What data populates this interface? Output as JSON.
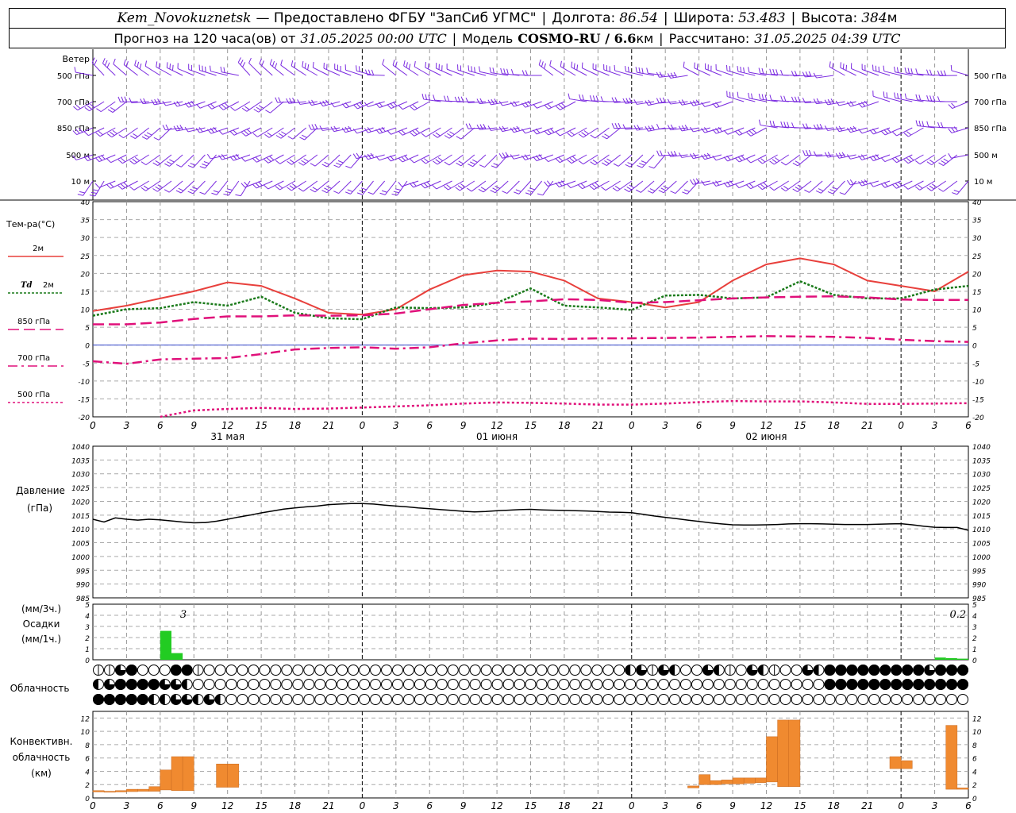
{
  "header": {
    "station": "Kem_Novokuznetsk",
    "provider": "— Предоставлено ФГБУ \"ЗапСиб УГМС\"",
    "lon_label": "Долгота:",
    "lon": "86.54",
    "lat_label": "Широта:",
    "lat": "53.483",
    "alt_label": "Высота:",
    "alt": "384",
    "alt_unit": "м",
    "forecast_label": "Прогноз на 120 часа(ов) от",
    "forecast_time": "31.05.2025 00:00 UTC",
    "model_label": "Модель",
    "model": "COSMO-RU / 6.6",
    "model_unit": "км",
    "calc_label": "Рассчитано:",
    "calc_time": "31.05.2025 04:39 UTC"
  },
  "colors": {
    "t2m": "#e8403c",
    "td": "#1a7a1a",
    "t850": "#e0107a",
    "t700": "#e0107a",
    "t500": "#e0107a",
    "wind": "#7a2ae0",
    "pressure": "#000000",
    "precip": "#22cc22",
    "conv": "#f08a30"
  },
  "time_axis": {
    "hour_ticks": [
      "0",
      "3",
      "6",
      "9",
      "12",
      "15",
      "18",
      "21",
      "0",
      "3",
      "6",
      "9",
      "12",
      "15",
      "18",
      "21",
      "0",
      "3",
      "6",
      "9",
      "12",
      "15",
      "18",
      "21",
      "0",
      "3",
      "6"
    ],
    "day_labels": [
      {
        "step": 4,
        "text": "31 мая"
      },
      {
        "step": 12,
        "text": "01 июня"
      },
      {
        "step": 20,
        "text": "02 июня"
      }
    ]
  },
  "wind_panel": {
    "label_title": "Ветер",
    "levels": [
      "500 гПа",
      "700 гПа",
      "850 гПа",
      "500 м",
      "10 м"
    ]
  },
  "chart_data": [
    {
      "type": "line",
      "title": "Тем-ра(°С)",
      "ylim": [
        -20,
        40
      ],
      "yticks": [
        -20,
        -15,
        -10,
        -5,
        0,
        5,
        10,
        15,
        20,
        25,
        30,
        35,
        40
      ],
      "x_unit": "hours from 31.05.2025 00:00 UTC",
      "series": [
        {
          "name": "2м",
          "key": "t2m",
          "x": [
            0,
            3,
            6,
            9,
            12,
            15,
            18,
            21,
            24,
            27,
            30,
            33,
            36,
            39,
            42,
            45,
            48,
            51,
            54,
            57,
            60,
            63,
            66,
            69,
            72,
            75,
            78
          ],
          "values": [
            9.5,
            11,
            13,
            15,
            17.5,
            16.5,
            13,
            9,
            8.5,
            10,
            15.5,
            19.5,
            20.8,
            20.5,
            18,
            13,
            12,
            10.5,
            12,
            18,
            22.5,
            24.2,
            22.5,
            18,
            16.5,
            15,
            20.5
          ]
        },
        {
          "name": "Td 2м",
          "key": "td",
          "x": [
            0,
            3,
            6,
            9,
            12,
            15,
            18,
            21,
            24,
            27,
            30,
            33,
            36,
            39,
            42,
            45,
            48,
            51,
            54,
            57,
            60,
            63,
            66,
            69,
            72,
            75,
            78
          ],
          "values": [
            8.2,
            10,
            10.3,
            12,
            11,
            13.5,
            9,
            7.5,
            7.2,
            10.5,
            10.3,
            10.5,
            11.8,
            15.8,
            11,
            10.5,
            9.8,
            13.8,
            14,
            13,
            13.3,
            17.8,
            14,
            13,
            13,
            15.5,
            16.5
          ]
        },
        {
          "name": "850 гПа",
          "key": "t850",
          "x": [
            0,
            3,
            6,
            9,
            12,
            15,
            18,
            21,
            24,
            27,
            30,
            33,
            36,
            39,
            42,
            45,
            48,
            51,
            54,
            57,
            60,
            63,
            66,
            69,
            72,
            75,
            78
          ],
          "values": [
            5.8,
            5.8,
            6.3,
            7.3,
            8,
            8,
            8.3,
            8.2,
            8.3,
            8.8,
            10,
            11.2,
            11.8,
            12.2,
            12.8,
            12.6,
            11.8,
            12,
            12.5,
            13,
            13.3,
            13.5,
            13.6,
            13.3,
            12.7,
            12.6,
            12.6
          ]
        },
        {
          "name": "700 гПа",
          "key": "t700",
          "x": [
            0,
            3,
            6,
            9,
            12,
            15,
            18,
            21,
            24,
            27,
            30,
            33,
            36,
            39,
            42,
            45,
            48,
            51,
            54,
            57,
            60,
            63,
            66,
            69,
            72,
            75,
            78
          ],
          "values": [
            -4.5,
            -5.2,
            -4,
            -3.8,
            -3.6,
            -2.5,
            -1.2,
            -0.8,
            -0.6,
            -1,
            -0.6,
            0.5,
            1.3,
            1.8,
            1.7,
            1.9,
            1.9,
            2,
            2.1,
            2.3,
            2.5,
            2.4,
            2.3,
            2,
            1.5,
            1.1,
            0.9
          ]
        },
        {
          "name": "500 гПа",
          "key": "t500",
          "x": [
            6,
            9,
            12,
            15,
            18,
            21,
            24,
            27,
            30,
            33,
            36,
            39,
            42,
            45,
            48,
            51,
            54,
            57,
            60,
            63,
            66,
            69,
            72,
            75,
            78
          ],
          "values": [
            -20,
            -18.2,
            -17.8,
            -17.5,
            -17.8,
            -17.7,
            -17.4,
            -17.1,
            -16.8,
            -16.3,
            -16,
            -16.1,
            -16.3,
            -16.6,
            -16.6,
            -16.3,
            -15.9,
            -15.6,
            -15.7,
            -15.7,
            -16,
            -16.4,
            -16.4,
            -16.3,
            -16.2
          ]
        }
      ],
      "legend_labels": [
        "2м",
        "Td",
        "2м",
        "850 гПа",
        "700 гПа",
        "500 гПа"
      ]
    },
    {
      "type": "line",
      "title": "Давление",
      "ylabel": "(гПа)",
      "ylim": [
        985,
        1040
      ],
      "yticks": [
        985,
        990,
        995,
        1000,
        1005,
        1010,
        1015,
        1020,
        1025,
        1030,
        1035,
        1040
      ],
      "x": [
        0,
        1,
        2,
        3,
        4,
        5,
        6,
        7,
        8,
        9,
        10,
        11,
        12,
        13,
        14,
        15,
        16,
        17,
        18,
        19,
        20,
        21,
        22,
        23,
        24,
        25,
        26,
        27,
        28,
        29,
        30,
        31,
        32,
        33,
        34,
        35,
        36,
        37,
        38,
        39,
        40,
        41,
        42,
        43,
        44,
        45,
        46,
        47,
        48,
        49,
        50,
        51,
        52,
        53,
        54,
        55,
        56,
        57,
        58,
        59,
        60,
        61,
        62,
        63,
        64,
        65,
        66,
        67,
        68,
        69,
        70,
        71,
        72,
        73,
        74,
        75,
        76,
        77,
        78
      ],
      "values": [
        1013.5,
        1012.5,
        1014,
        1013.5,
        1013.2,
        1013.5,
        1013.3,
        1012.9,
        1012.5,
        1012.2,
        1012.3,
        1012.8,
        1013.5,
        1014.3,
        1015,
        1015.8,
        1016.5,
        1017.2,
        1017.6,
        1018,
        1018.3,
        1018.8,
        1019,
        1019.2,
        1019.2,
        1019,
        1018.6,
        1018.3,
        1018,
        1017.6,
        1017.3,
        1017,
        1016.7,
        1016.4,
        1016.2,
        1016.3,
        1016.6,
        1016.8,
        1017,
        1017.1,
        1016.9,
        1016.8,
        1016.7,
        1016.6,
        1016.5,
        1016.3,
        1016.1,
        1016,
        1015.9,
        1015.3,
        1014.7,
        1014.2,
        1013.7,
        1013.2,
        1012.7,
        1012.2,
        1011.8,
        1011.5,
        1011.4,
        1011.4,
        1011.5,
        1011.6,
        1011.8,
        1011.9,
        1011.9,
        1011.8,
        1011.7,
        1011.6,
        1011.6,
        1011.6,
        1011.7,
        1011.8,
        1011.9,
        1011.5,
        1011,
        1010.6,
        1010.5,
        1010.5,
        1009.5
      ]
    },
    {
      "type": "bar",
      "title": "Осадки",
      "ylabel_top": "(мм/3ч.)",
      "ylabel_bottom": "(мм/1ч.)",
      "ylim": [
        0,
        5
      ],
      "yticks": [
        0,
        1,
        2,
        3,
        4,
        5
      ],
      "bars": [
        {
          "x": 6,
          "values": [
            2.6,
            0.6,
            0
          ]
        },
        {
          "x": 75,
          "values": [
            0.2,
            0.15,
            0.1
          ]
        }
      ],
      "totals": [
        {
          "x": 7.5,
          "text": "3"
        },
        {
          "x": 76.5,
          "text": "0.2"
        }
      ]
    },
    {
      "type": "bar",
      "title": "Конвективн. облачность",
      "ylabel": "(км)",
      "ylim": [
        0,
        13
      ],
      "yticks": [
        0,
        2,
        4,
        6,
        8,
        10,
        12
      ],
      "bars": [
        {
          "x0": 0,
          "x1": 1,
          "base": 0.9,
          "top": 1.1
        },
        {
          "x0": 1,
          "x1": 2,
          "base": 0.85,
          "top": 1.0
        },
        {
          "x0": 2,
          "x1": 3,
          "base": 0.9,
          "top": 1.1
        },
        {
          "x0": 3,
          "x1": 4,
          "base": 0.95,
          "top": 1.3
        },
        {
          "x0": 4,
          "x1": 5,
          "base": 1.0,
          "top": 1.3
        },
        {
          "x0": 5,
          "x1": 6,
          "base": 1.0,
          "top": 1.7
        },
        {
          "x0": 6,
          "x1": 7,
          "base": 1.2,
          "top": 4.2
        },
        {
          "x0": 7,
          "x1": 8,
          "base": 1.1,
          "top": 6.2
        },
        {
          "x0": 8,
          "x1": 9,
          "base": 1.1,
          "top": 6.2
        },
        {
          "x0": 11,
          "x1": 12,
          "base": 1.6,
          "top": 5.1
        },
        {
          "x0": 12,
          "x1": 13,
          "base": 1.6,
          "top": 5.1
        },
        {
          "x0": 53,
          "x1": 54,
          "base": 1.5,
          "top": 1.8
        },
        {
          "x0": 54,
          "x1": 55,
          "base": 2.0,
          "top": 3.5
        },
        {
          "x0": 55,
          "x1": 56,
          "base": 2.0,
          "top": 2.6
        },
        {
          "x0": 56,
          "x1": 57,
          "base": 2.1,
          "top": 2.7
        },
        {
          "x0": 57,
          "x1": 58,
          "base": 2.1,
          "top": 3.0
        },
        {
          "x0": 58,
          "x1": 59,
          "base": 2.2,
          "top": 3.0
        },
        {
          "x0": 59,
          "x1": 60,
          "base": 2.3,
          "top": 3.0
        },
        {
          "x0": 60,
          "x1": 61,
          "base": 2.4,
          "top": 9.2
        },
        {
          "x0": 61,
          "x1": 62,
          "base": 1.7,
          "top": 11.7
        },
        {
          "x0": 62,
          "x1": 63,
          "base": 1.7,
          "top": 11.7
        },
        {
          "x0": 71,
          "x1": 72,
          "base": 4.4,
          "top": 6.2
        },
        {
          "x0": 72,
          "x1": 73,
          "base": 4.4,
          "top": 5.6
        },
        {
          "x0": 76,
          "x1": 77,
          "base": 1.3,
          "top": 10.9
        },
        {
          "x0": 77,
          "x1": 78,
          "base": 1.3,
          "top": 1.5
        }
      ]
    }
  ],
  "cloud_panel": {
    "title": "Облачность",
    "rows": [
      "0002000000000003000000000000000000000000000000000000000000000000000000000000000000000000000000000000000000000000000000000000000000000000000000000000000000000000000000000000000000000000000000000000000000000000000000000000000000000000000000000000000000000000000000000000000000000000000000000000000000000000",
      "2444440000000000000000000000000000000000000000000000000000000000000000000000000000",
      "4444444000000000000000000000000000000000000000000000000000000000000000000000000000"
    ],
    "top_row": [
      1,
      1,
      3,
      4,
      0,
      0,
      0,
      4,
      4,
      1,
      0,
      0,
      0,
      0,
      0,
      0,
      0,
      0,
      0,
      0,
      0,
      0,
      0,
      0,
      0,
      0,
      0,
      0,
      0,
      0,
      0,
      0,
      0,
      0,
      0,
      0,
      0,
      0,
      0,
      0,
      0,
      0,
      0,
      0,
      0,
      0,
      0,
      0,
      2,
      3,
      1,
      3,
      2,
      0,
      0,
      3,
      2,
      1,
      0,
      3,
      2,
      1,
      0,
      0,
      3,
      2,
      4,
      4,
      4,
      4,
      4,
      4,
      4,
      4,
      4,
      3,
      4,
      4,
      4
    ],
    "mid_row": [
      2,
      3,
      4,
      4,
      4,
      4,
      3,
      3,
      2,
      0,
      0,
      0,
      0,
      0,
      0,
      0,
      0,
      0,
      0,
      0,
      0,
      0,
      0,
      0,
      0,
      0,
      0,
      0,
      0,
      0,
      0,
      0,
      0,
      0,
      0,
      0,
      0,
      0,
      0,
      0,
      0,
      0,
      0,
      0,
      0,
      0,
      0,
      0,
      0,
      0,
      0,
      0,
      0,
      0,
      0,
      0,
      0,
      0,
      0,
      0,
      0,
      0,
      0,
      0,
      0,
      0,
      4,
      4,
      4,
      4,
      4,
      4,
      4,
      4,
      4,
      4,
      4,
      4,
      4
    ],
    "low_row": [
      4,
      4,
      4,
      4,
      4,
      2,
      2,
      3,
      3,
      2,
      3,
      2,
      0,
      0,
      0,
      0,
      0,
      0,
      0,
      0,
      0,
      0,
      0,
      0,
      0,
      0,
      0,
      0,
      0,
      0,
      0,
      0,
      0,
      0,
      0,
      0,
      0,
      0,
      0,
      0,
      0,
      0,
      0,
      0,
      0,
      0,
      0,
      0,
      0,
      0,
      0,
      0,
      0,
      0,
      0,
      0,
      0,
      0,
      0,
      0,
      0,
      0,
      0,
      0,
      0,
      0,
      0,
      0,
      0,
      0,
      0,
      0,
      0,
      0,
      0,
      0,
      0,
      0,
      0
    ]
  }
}
